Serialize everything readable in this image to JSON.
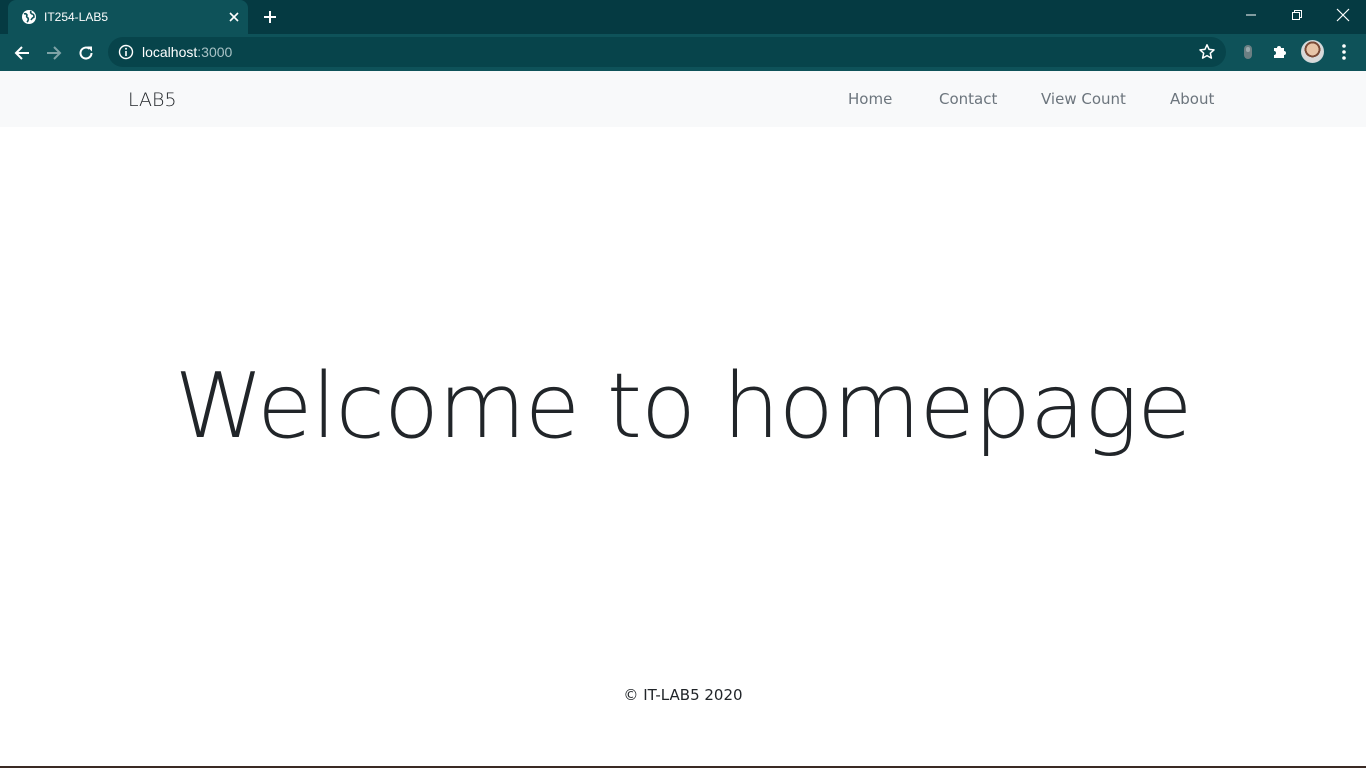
{
  "browser": {
    "tab": {
      "title": "IT254-LAB5",
      "favicon": "globe-icon"
    },
    "address_bar": {
      "host": "localhost",
      "port": ":3000"
    },
    "colors": {
      "titlebar": "#053a42",
      "toolbar": "#0e5259",
      "omnibox": "#07444b"
    }
  },
  "navbar": {
    "brand": "LAB5",
    "links": [
      {
        "label": "Home"
      },
      {
        "label": "Contact"
      },
      {
        "label": "View Count"
      },
      {
        "label": "About"
      }
    ]
  },
  "main": {
    "heading": "Welcome to homepage"
  },
  "footer": {
    "text": "© IT-LAB5 2020"
  }
}
